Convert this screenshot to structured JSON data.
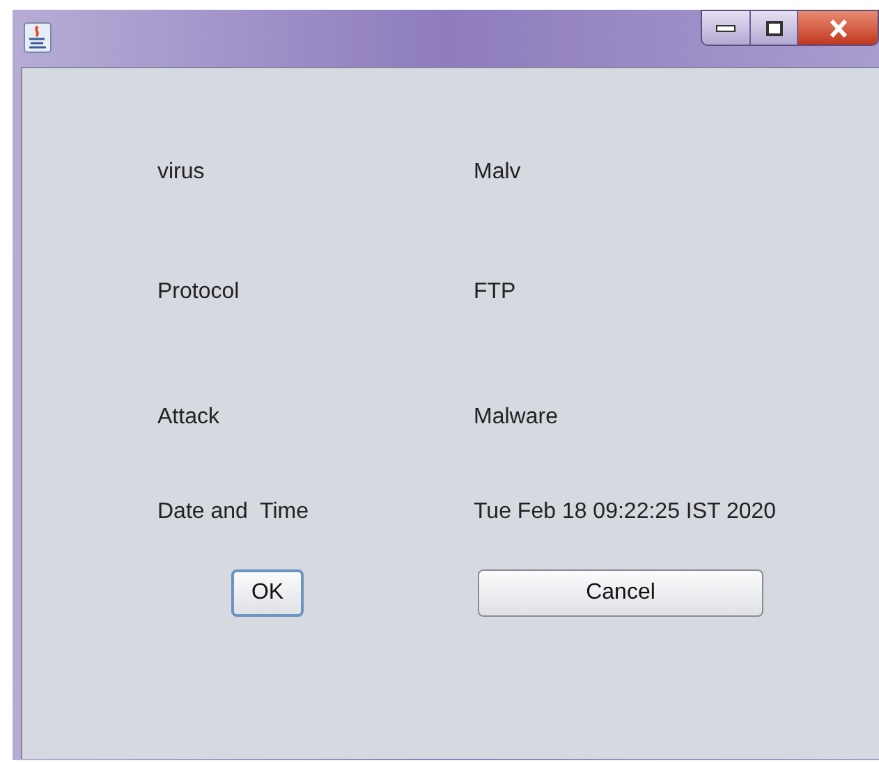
{
  "fields": [
    {
      "label": "virus",
      "value": "Malv"
    },
    {
      "label": "Protocol",
      "value": "FTP"
    },
    {
      "label": "Attack",
      "value": "Malware"
    },
    {
      "label": "Date and  Time",
      "value": "Tue Feb 18 09:22:25 IST 2020"
    }
  ],
  "buttons": [
    {
      "label": "OK",
      "focused": true
    },
    {
      "label": "Cancel",
      "focused": false
    }
  ]
}
